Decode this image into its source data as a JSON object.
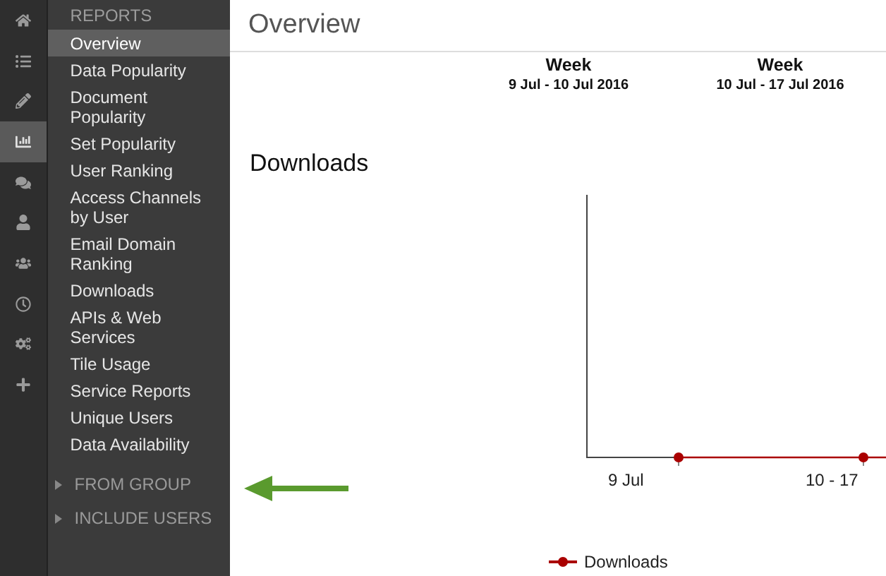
{
  "rail": [
    {
      "selected": false
    },
    {
      "selected": false
    },
    {
      "selected": false
    },
    {
      "selected": true
    },
    {
      "selected": false
    },
    {
      "selected": false
    },
    {
      "selected": false
    },
    {
      "selected": false
    },
    {
      "selected": false
    },
    {
      "selected": false
    }
  ],
  "menu": {
    "heading": "REPORTS",
    "items": [
      {
        "label": "Overview",
        "selected": true
      },
      {
        "label": "Data Popularity",
        "selected": false
      },
      {
        "label": "Document Popularity",
        "selected": false
      },
      {
        "label": "Set Popularity",
        "selected": false
      },
      {
        "label": "User Ranking",
        "selected": false
      },
      {
        "label": "Access Channels by User",
        "selected": false
      },
      {
        "label": "Email Domain Ranking",
        "selected": false
      },
      {
        "label": "Downloads",
        "selected": false
      },
      {
        "label": "APIs & Web Services",
        "selected": false
      },
      {
        "label": "Tile Usage",
        "selected": false
      },
      {
        "label": "Service Reports",
        "selected": false
      },
      {
        "label": "Unique Users",
        "selected": false
      },
      {
        "label": "Data Availability",
        "selected": false
      }
    ],
    "groups": [
      {
        "label": "FROM GROUP",
        "expanded": false
      },
      {
        "label": "INCLUDE USERS",
        "expanded": false
      }
    ]
  },
  "page": {
    "title": "Overview",
    "columns": [
      {
        "heading": "Week",
        "range": "9 Jul - 10 Jul 2016"
      },
      {
        "heading": "Week",
        "range": "10 Jul - 17 Jul 2016"
      }
    ],
    "chart": {
      "title": "Downloads",
      "x_labels": [
        "9 Jul",
        "10 - 17"
      ],
      "legend": "Downloads"
    }
  }
}
